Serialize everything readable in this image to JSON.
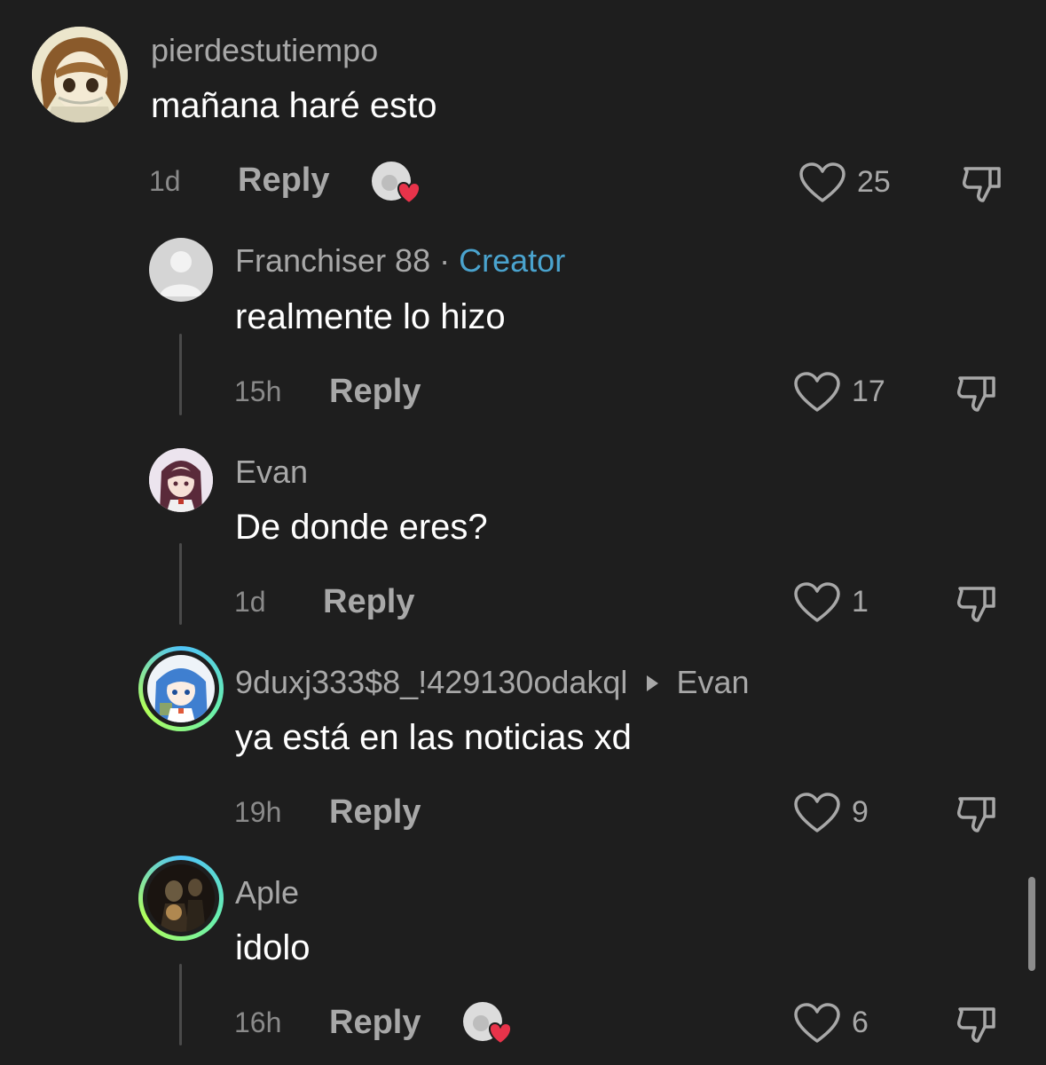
{
  "comments": [
    {
      "username": "pierdestutiempo",
      "text": "mañana haré esto",
      "time": "1d",
      "reply": "Reply",
      "likes": "25",
      "creator_liked": true
    },
    {
      "username": "Franchiser 88",
      "separator": "·",
      "badge": "Creator",
      "text": "realmente lo hizo",
      "time": "15h",
      "reply": "Reply",
      "likes": "17"
    },
    {
      "username": "Evan",
      "text": "De donde eres?",
      "time": "1d",
      "reply": "Reply",
      "likes": "1"
    },
    {
      "username": "9duxj333$8_!429130odakql",
      "reply_to": "Evan",
      "text": "ya está en las noticias xd",
      "time": "19h",
      "reply": "Reply",
      "likes": "9",
      "story_ring": true
    },
    {
      "username": "Aple",
      "text": "idolo",
      "time": "16h",
      "reply": "Reply",
      "likes": "6",
      "story_ring": true,
      "creator_liked": true
    }
  ],
  "colors": {
    "background": "#1e1e1e",
    "creator_badge": "#4aa3ce",
    "heart_red": "#e8334a",
    "story_ring": "#4fc3f7"
  },
  "icons": {
    "like": "heart-outline-icon",
    "dislike": "thumbs-down-icon",
    "liked_by_creator": "creator-heart-badge-icon"
  }
}
